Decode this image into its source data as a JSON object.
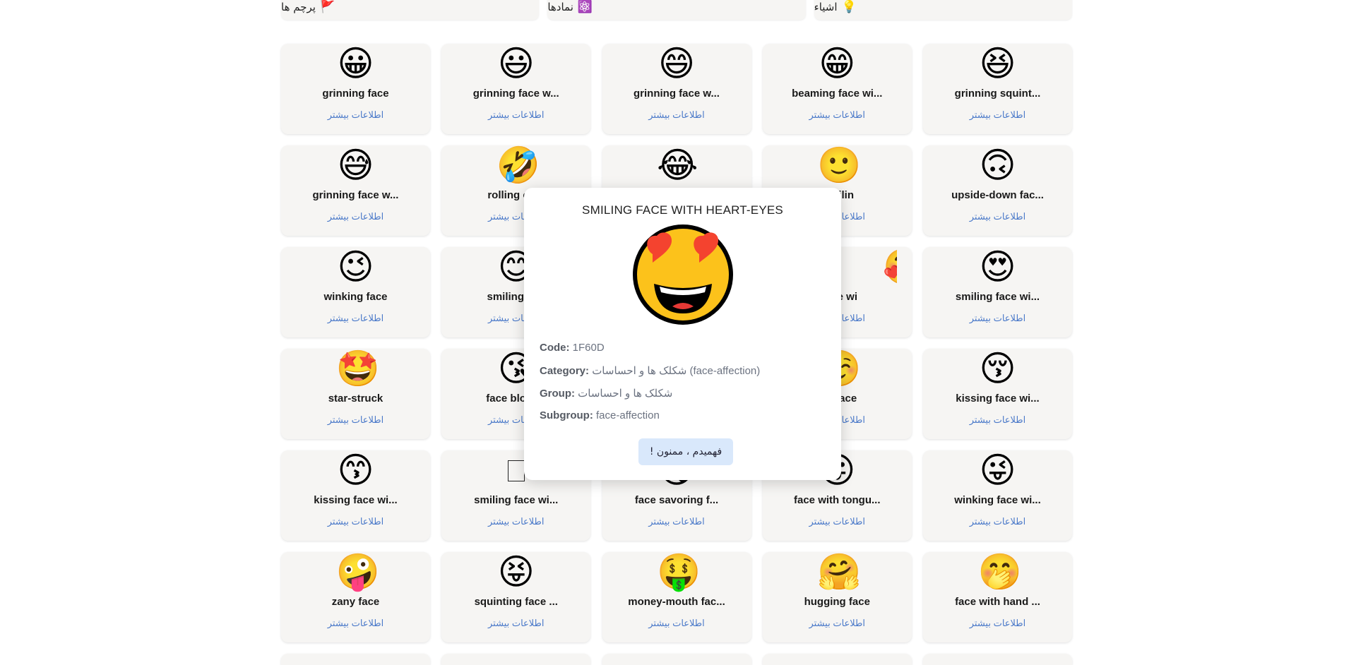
{
  "tabs": [
    {
      "label": "پرچم ها",
      "icon": "🚩",
      "icon_name": "flag-icon"
    },
    {
      "label": "نمادها",
      "icon": "⚛️",
      "icon_name": "atom-symbol-icon"
    },
    {
      "label": "اشیاء",
      "icon": "💡",
      "icon_name": "light-bulb-icon"
    }
  ],
  "more_label": "اطلاعات بیشتر",
  "cards": [
    {
      "emoji": "😀",
      "name": "grinning face"
    },
    {
      "emoji": "😃",
      "name": "grinning face w..."
    },
    {
      "emoji": "😄",
      "name": "grinning face w..."
    },
    {
      "emoji": "😁",
      "name": "beaming face wi..."
    },
    {
      "emoji": "😆",
      "name": "grinning squint..."
    },
    {
      "emoji": "😅",
      "name": "grinning face w..."
    },
    {
      "emoji": "🤣",
      "name": "rolling on..."
    },
    {
      "emoji": "😂",
      "name": ""
    },
    {
      "emoji": "🙂",
      "name": "...milin"
    },
    {
      "emoji": "🙃",
      "name": "upside-down fac..."
    },
    {
      "emoji": "😉",
      "name": "winking face"
    },
    {
      "emoji": "😊",
      "name": "smiling fa..."
    },
    {
      "emoji": "🥰",
      "name": "...ace wi"
    },
    {
      "emoji": "",
      "name": ""
    },
    {
      "emoji": "😍",
      "name": "smiling face wi..."
    },
    {
      "emoji": "🤩",
      "name": "star-struck"
    },
    {
      "emoji": "😘",
      "name": "face blowi..."
    },
    {
      "emoji": "",
      "name": ""
    },
    {
      "emoji": "☺️",
      "name": "...g face"
    },
    {
      "emoji": "😚",
      "name": "kissing face wi..."
    },
    {
      "emoji": "😙",
      "name": "kissing face wi..."
    },
    {
      "emoji": "",
      "name": "smiling face wi..."
    },
    {
      "emoji": "😋",
      "name": "face savoring f..."
    },
    {
      "emoji": "😛",
      "name": "face with tongu..."
    },
    {
      "emoji": "😜",
      "name": "winking face wi..."
    },
    {
      "emoji": "🤪",
      "name": "zany face"
    },
    {
      "emoji": "😝",
      "name": "squinting face ..."
    },
    {
      "emoji": "🤑",
      "name": "money-mouth fac..."
    },
    {
      "emoji": "🤗",
      "name": "hugging face"
    },
    {
      "emoji": "🤭",
      "name": "face with hand ..."
    }
  ],
  "modal": {
    "title": "SMILING FACE WITH HEART-EYES",
    "emoji_name": "smiling-face-with-heart-eyes-icon",
    "code_label": "Code:",
    "code": "1F60D",
    "category_label": "Category:",
    "category": "شکلک ها و احساسات (face-affection)",
    "group_label": "Group:",
    "group": "شکلک ها و احساسات",
    "subgroup_label": "Subgroup:",
    "subgroup": "face-affection",
    "ok_button": "فهمیدم ، ممنون !"
  }
}
